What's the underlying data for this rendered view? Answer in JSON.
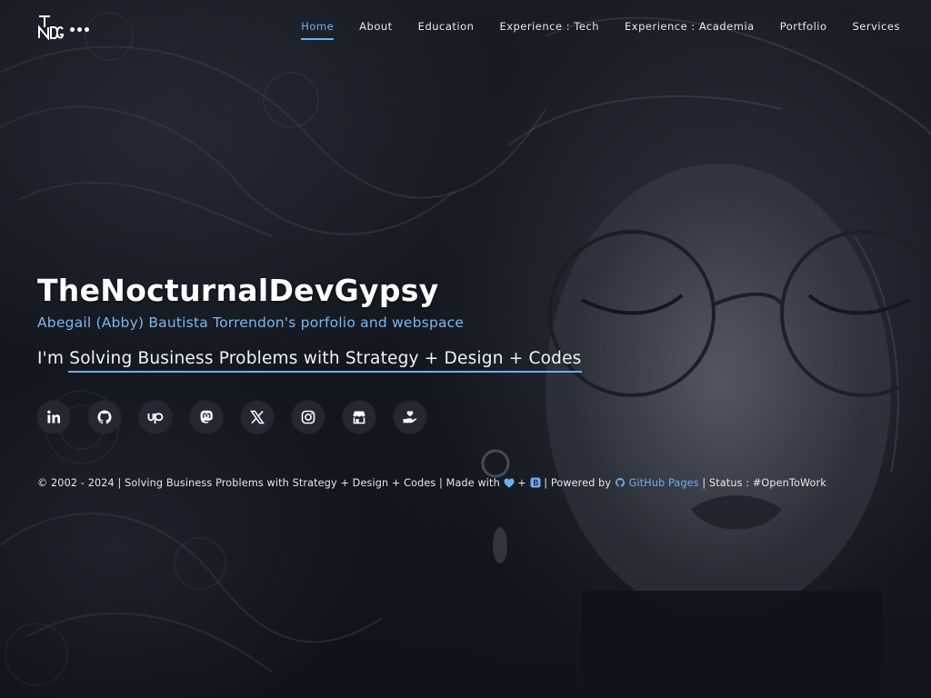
{
  "brand": {
    "logo_icon": "tndg-monogram",
    "menu_icon": "more-dots-icon"
  },
  "nav": {
    "items": [
      {
        "label": "Home",
        "active": true
      },
      {
        "label": "About"
      },
      {
        "label": "Education"
      },
      {
        "label": "Experience : Tech"
      },
      {
        "label": "Experience : Academia"
      },
      {
        "label": "Portfolio"
      },
      {
        "label": "Services"
      }
    ]
  },
  "hero": {
    "title": "TheNocturnalDevGypsy",
    "subtitle": "Abegail (Abby) Bautista Torrendon's porfolio and webspace",
    "tagline_prefix": "I'm ",
    "tagline_typed": "Solving Business Problems with Strategy + Design + Codes"
  },
  "socials": [
    {
      "name": "linkedin",
      "icon": "linkedin-icon"
    },
    {
      "name": "github",
      "icon": "github-icon"
    },
    {
      "name": "upwork",
      "icon": "upwork-icon"
    },
    {
      "name": "mastodon",
      "icon": "mastodon-icon"
    },
    {
      "name": "x",
      "icon": "x-icon"
    },
    {
      "name": "instagram",
      "icon": "instagram-icon"
    },
    {
      "name": "store",
      "icon": "store-icon"
    },
    {
      "name": "donate",
      "icon": "hand-heart-icon"
    }
  ],
  "footer": {
    "copyright": "© 2002 - 2024 | Solving Business Problems with Strategy + Design + Codes | Made with",
    "plus": "+",
    "powered_by": "| Powered by",
    "github_pages": "GitHub Pages",
    "status": "| Status : #OpenToWork"
  },
  "colors": {
    "accent": "#6fb0ec",
    "background": "#151922",
    "text": "#e8ebf0"
  }
}
